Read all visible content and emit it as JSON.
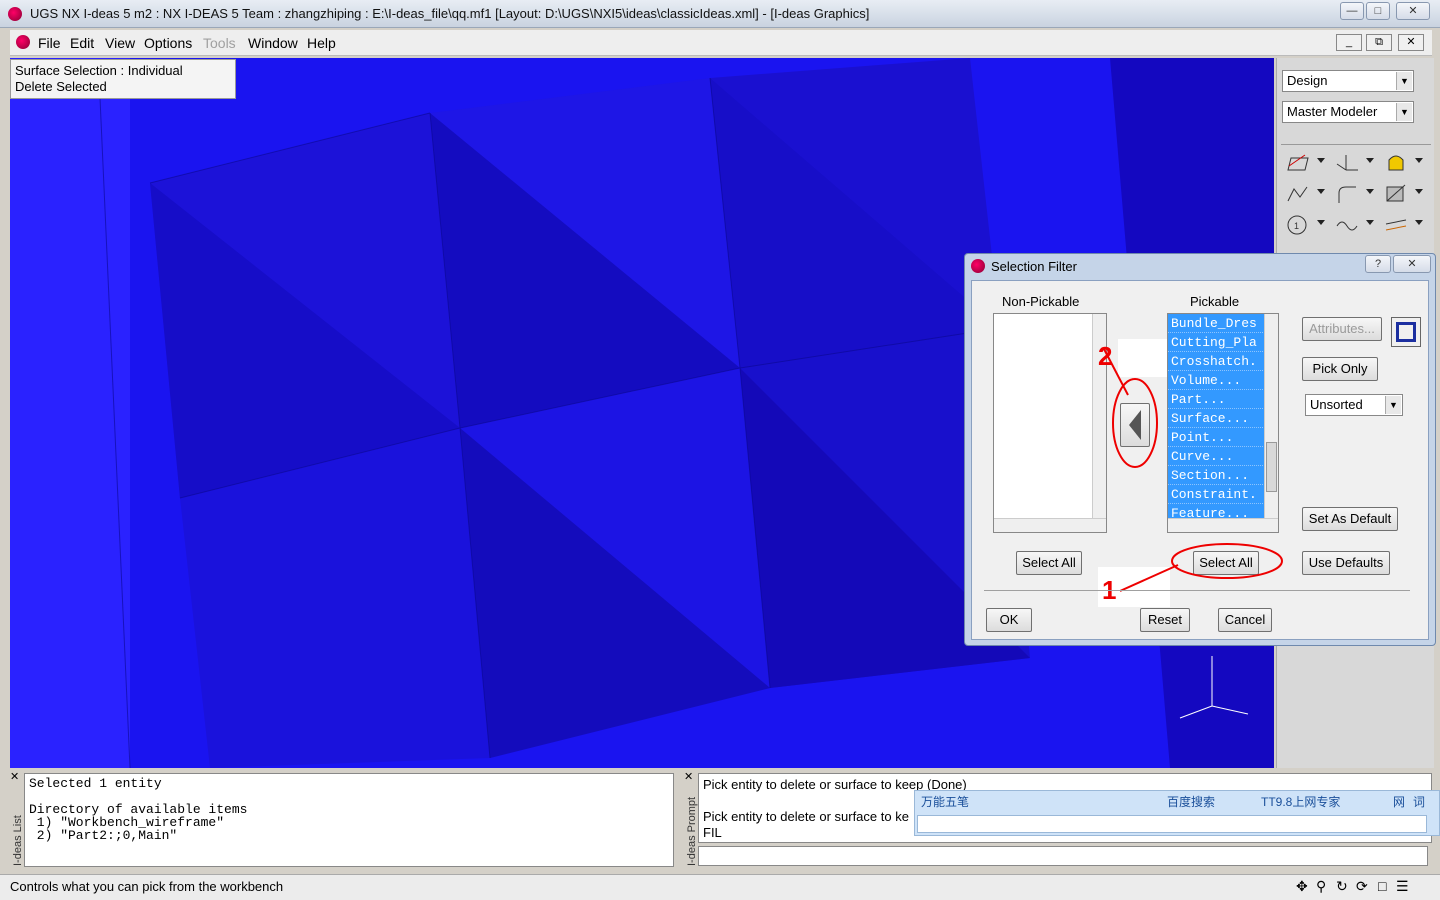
{
  "window": {
    "title": "UGS NX I-deas 5 m2 :    NX I-DEAS 5 Team : zhangzhiping : E:\\I-deas_file\\qq.mf1   [Layout: D:\\UGS\\NXI5\\ideas\\classicIdeas.xml]    - [I-deas Graphics]"
  },
  "menubar": {
    "items": [
      "File",
      "Edit",
      "View",
      "Options",
      "Tools",
      "Window",
      "Help"
    ]
  },
  "viewport": {
    "status_line1": "Surface Selection : Individual",
    "status_line2": "Delete Selected",
    "background_color": "#1a14f0"
  },
  "rightpanel": {
    "app_select": "Design",
    "task_select": "Master Modeler"
  },
  "dialog": {
    "title": "Selection Filter",
    "non_pickable_label": "Non-Pickable",
    "pickable_label": "Pickable",
    "pickable_items": [
      "Bundle_Dres",
      "Cutting_Pla",
      "Crosshatch.",
      "Volume...",
      "Part...",
      "Surface...",
      "Point...",
      "Curve...",
      "Section...",
      "Constraint.",
      "Feature..."
    ],
    "attributes_button": "Attributes...",
    "pick_only_button": "Pick Only",
    "sort_select": "Unsorted",
    "set_as_default_button": "Set As Default",
    "select_all_left": "Select All",
    "select_all_right": "Select All",
    "use_defaults_button": "Use Defaults",
    "ok_button": "OK",
    "reset_button": "Reset",
    "cancel_button": "Cancel",
    "annotation_1": "1",
    "annotation_2": "2",
    "annotation_color": "#e00000"
  },
  "listwindow": {
    "side_label": "I-deas List",
    "lines": [
      "Selected 1 entity",
      "",
      "Directory of available items",
      " 1) \"Workbench_wireframe\"",
      " 2) \"Part2:;0,Main\""
    ]
  },
  "prompt": {
    "side_label": "I-deas Prompt",
    "line1": "Pick entity to delete or surface to keep (Done)",
    "line2": "Pick entity to delete or surface to ke",
    "line3": "FIL"
  },
  "ime": {
    "tab1": "万能五笔",
    "tab2": "百度搜索",
    "tab3": "TT9.8上网专家",
    "tab4": "网",
    "tab5": "词"
  },
  "statusbar": {
    "text": "Controls what you can pick from the workbench"
  }
}
